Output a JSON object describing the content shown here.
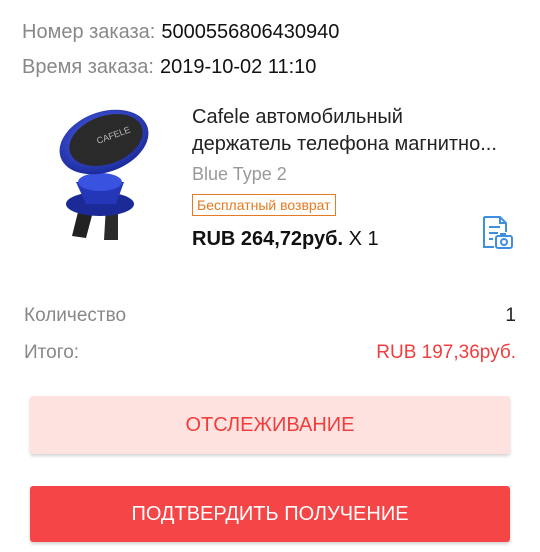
{
  "order": {
    "number_label": "Номер заказа:",
    "number_value": "5000556806430940",
    "time_label": "Время заказа:",
    "time_value": "2019-10-02 11:10"
  },
  "product": {
    "title_line1": "Cafele автомобильный",
    "title_line2": "держатель телефона магнитно...",
    "image_logo": "CAFELE",
    "variant": "Blue Type 2",
    "badge": "Бесплатный возврат",
    "price": "RUB 264,72руб.",
    "quantity_text": "X 1",
    "snapshot_icon": "document-camera-icon"
  },
  "summary": {
    "quantity_label": "Количество",
    "quantity_value": "1",
    "total_label": "Итого:",
    "total_value": "RUB 197,36руб."
  },
  "buttons": {
    "track_label": "ОТСЛЕЖИВАНИЕ",
    "confirm_label": "ПОДТВЕРДИТЬ ПОЛУЧЕНИЕ"
  },
  "colors": {
    "accent_red": "#f23d3d",
    "badge_orange": "#e57a20",
    "icon_blue": "#3f8fe0"
  }
}
